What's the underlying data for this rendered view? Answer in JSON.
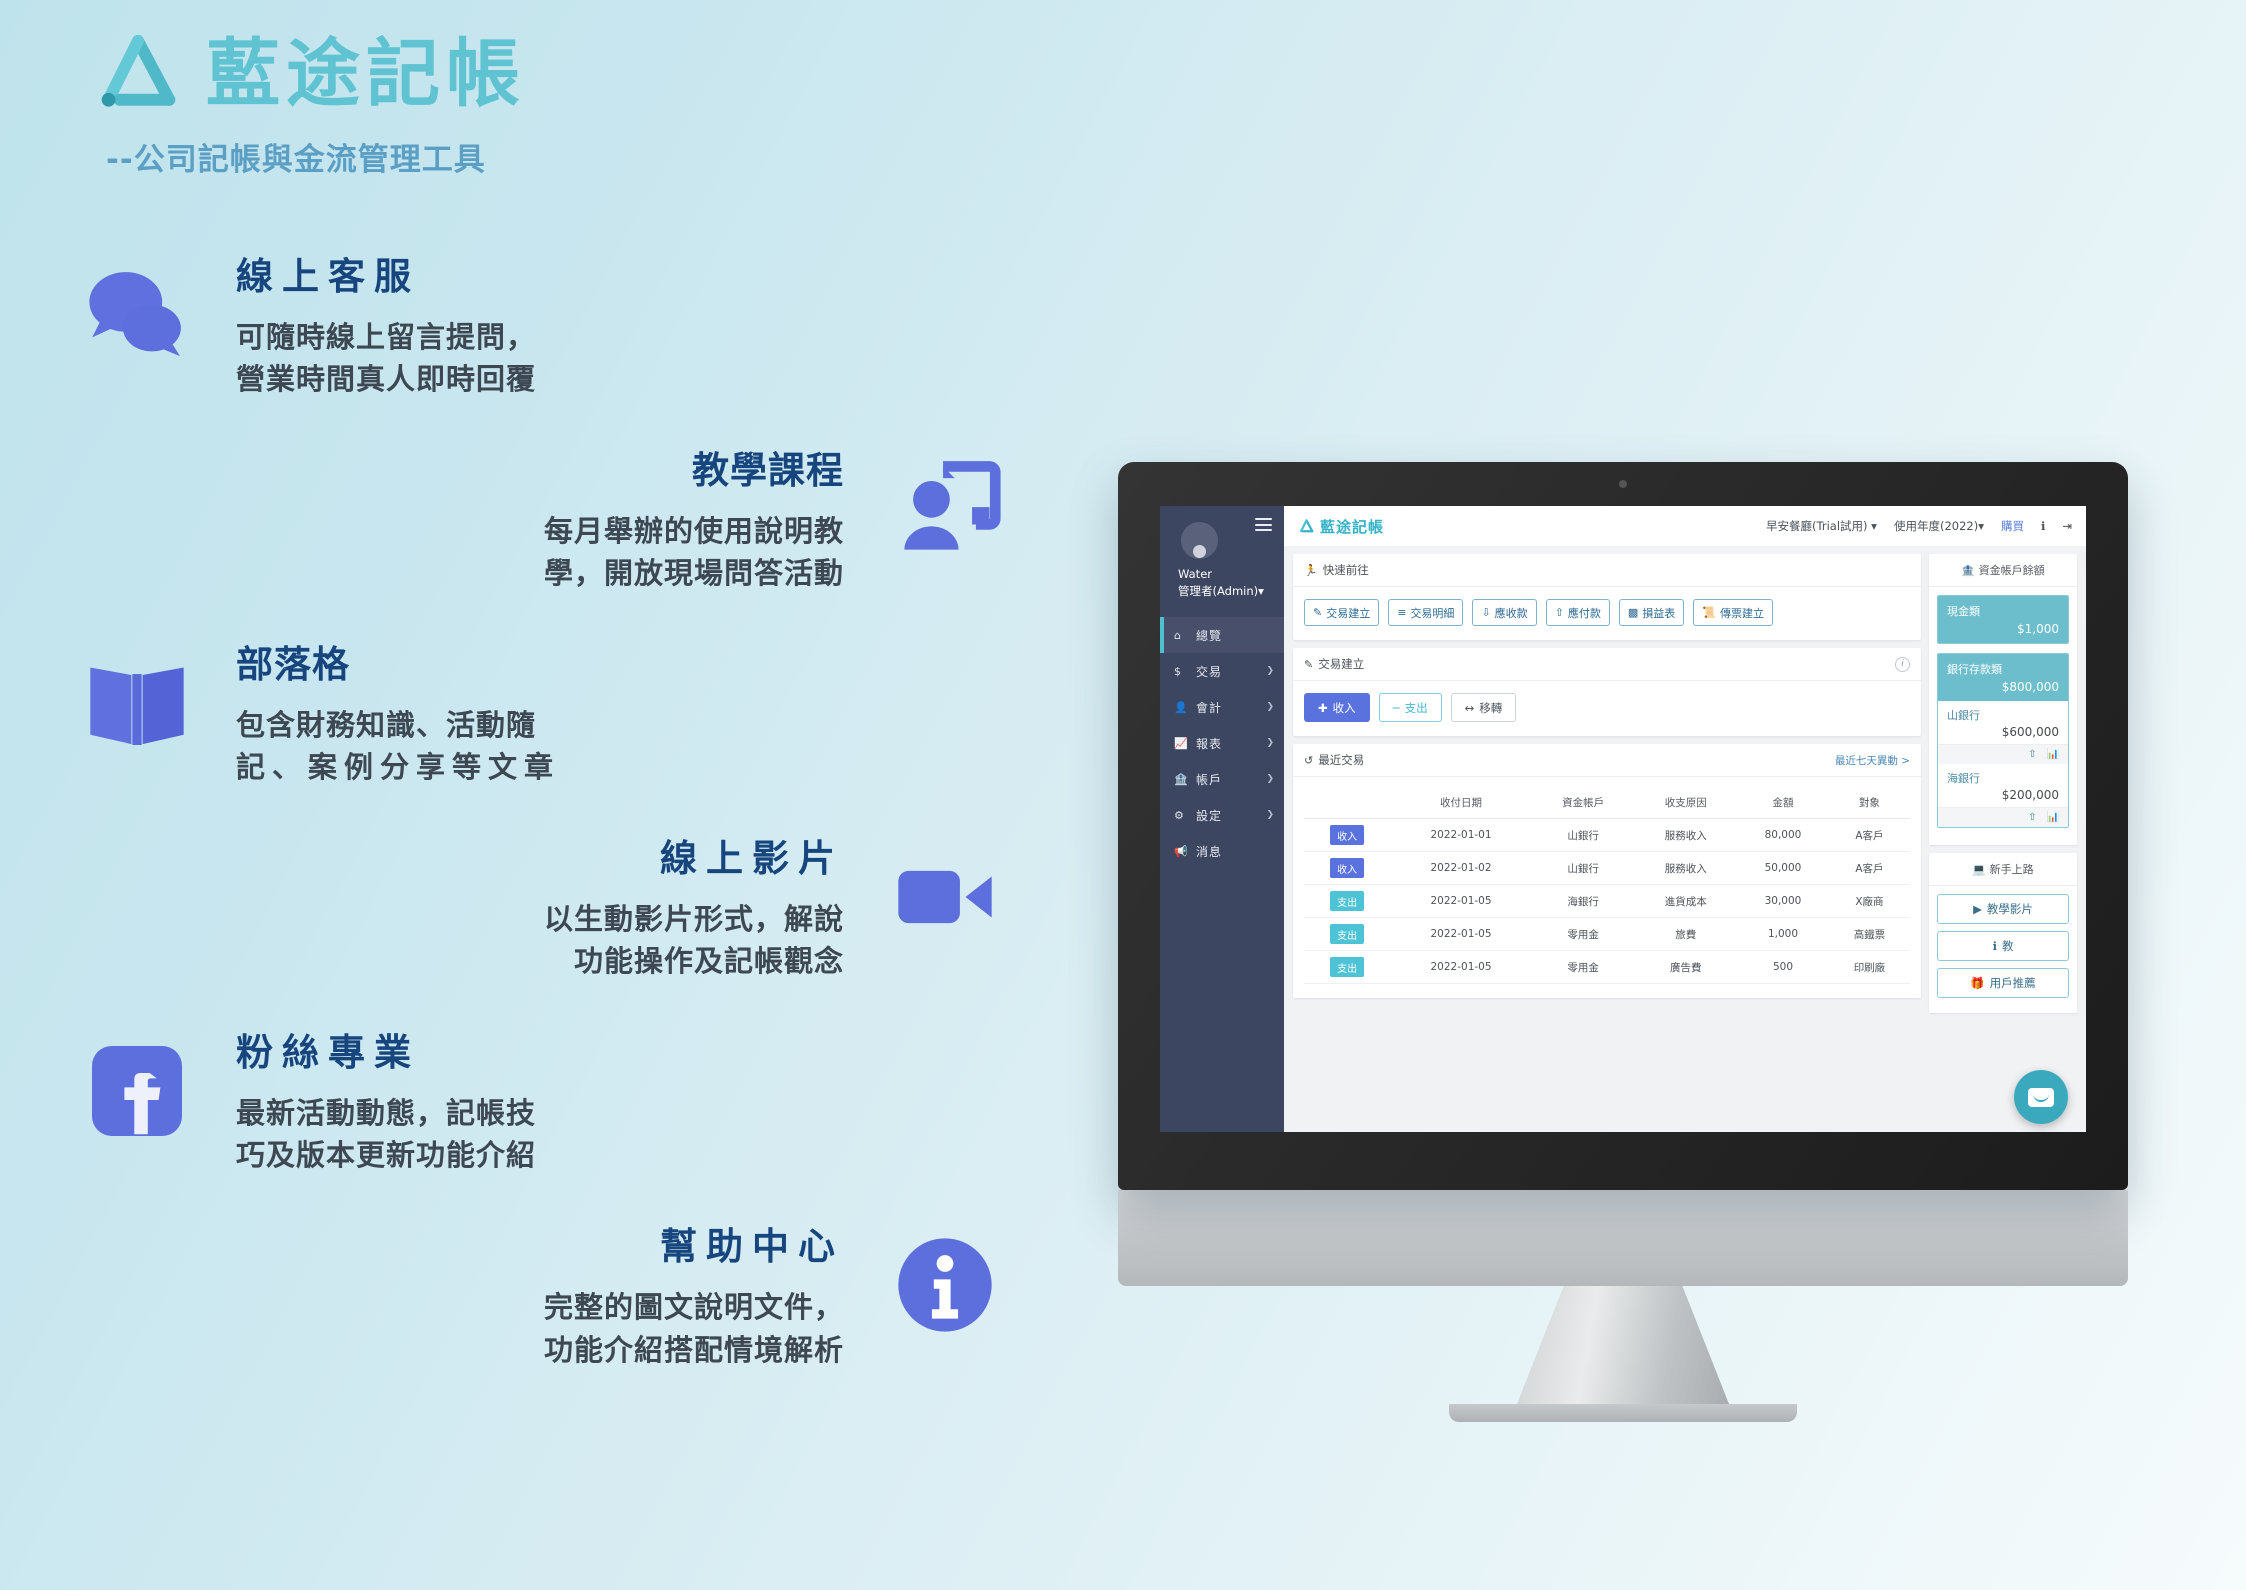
{
  "brand": {
    "title": "藍途記帳",
    "subtitle": "--公司記帳與金流管理工具",
    "logo_icon": "triangle-logo-icon"
  },
  "features": [
    {
      "title": "線上客服",
      "desc_line1": "可隨時線上留言提問，",
      "desc_line2": "營業時間真人即時回覆",
      "icon": "chat-bubbles-icon",
      "side": "left"
    },
    {
      "title": "教學課程",
      "desc_line1": "每月舉辦的使用說明教",
      "desc_line2": "學，開放現場問答活動",
      "icon": "presentation-person-icon",
      "side": "right"
    },
    {
      "title": "部落格",
      "desc_line1": "包含財務知識、活動隨",
      "desc_line2": "記、案例分享等文章",
      "icon": "open-book-icon",
      "side": "left"
    },
    {
      "title": "線上影片",
      "desc_line1": "以生動影片形式，解說",
      "desc_line2": "功能操作及記帳觀念",
      "icon": "video-camera-icon",
      "side": "right"
    },
    {
      "title": "粉絲專業",
      "desc_line1": "最新活動動態，記帳技",
      "desc_line2": "巧及版本更新功能介紹",
      "icon": "facebook-icon",
      "side": "left"
    },
    {
      "title": "幫助中心",
      "desc_line1": "完整的圖文說明文件，",
      "desc_line2": "功能介紹搭配情境解析",
      "icon": "info-circle-icon",
      "side": "right"
    }
  ],
  "app": {
    "sidebar": {
      "user_name": "Water",
      "user_role": "管理者(Admin)",
      "avatar": "user-avatar",
      "menu_icon": "hamburger-icon",
      "items": [
        {
          "label": "總覽",
          "icon": "home-icon",
          "caret": "",
          "active": true
        },
        {
          "label": "交易",
          "icon": "dollar-icon",
          "caret": "❯",
          "active": false
        },
        {
          "label": "會計",
          "icon": "person-icon",
          "caret": "❯",
          "active": false
        },
        {
          "label": "報表",
          "icon": "chart-icon",
          "caret": "❯",
          "active": false
        },
        {
          "label": "帳戶",
          "icon": "bank-icon",
          "caret": "❯",
          "active": false
        },
        {
          "label": "設定",
          "icon": "gear-icon",
          "caret": "❯",
          "active": false
        },
        {
          "label": "消息",
          "icon": "megaphone-icon",
          "caret": "",
          "active": false
        }
      ]
    },
    "header": {
      "logo_text": "藍途記帳",
      "company": "早安餐廳(Trial試用)",
      "company_caret": "▾",
      "year": "使用年度(2022)",
      "year_caret": "▾",
      "buy": "購買",
      "info_icon": "info-icon",
      "logout_icon": "logout-icon"
    },
    "quick_access": {
      "title": "快速前往",
      "icon": "runner-icon",
      "buttons": [
        {
          "label": "交易建立",
          "icon": "pencil-icon"
        },
        {
          "label": "交易明細",
          "icon": "list-icon"
        },
        {
          "label": "應收款",
          "icon": "receive-icon"
        },
        {
          "label": "應付款",
          "icon": "pay-icon"
        },
        {
          "label": "損益表",
          "icon": "bar-chart-icon"
        },
        {
          "label": "傳票建立",
          "icon": "voucher-icon"
        }
      ]
    },
    "create_tx": {
      "title": "交易建立",
      "icon": "pencil-icon",
      "info_icon": "info-circle-icon",
      "buttons": [
        {
          "label": "收入",
          "icon": "plus-icon",
          "style": "income"
        },
        {
          "label": "支出",
          "icon": "minus-icon",
          "style": "expense"
        },
        {
          "label": "移轉",
          "icon": "arrows-icon",
          "style": "transfer"
        }
      ]
    },
    "recent_tx": {
      "title": "最近交易",
      "icon": "history-icon",
      "link": "最近七天異動 >",
      "columns": [
        "",
        "收付日期",
        "資金帳戶",
        "收支原因",
        "金額",
        "對象"
      ],
      "rows": [
        {
          "tag": "收入",
          "type": "in",
          "date": "2022-01-01",
          "account": "山銀行",
          "reason": "服務收入",
          "amount": "80,000",
          "target": "A客戶"
        },
        {
          "tag": "收入",
          "type": "in",
          "date": "2022-01-02",
          "account": "山銀行",
          "reason": "服務收入",
          "amount": "50,000",
          "target": "A客戶"
        },
        {
          "tag": "支出",
          "type": "out",
          "date": "2022-01-05",
          "account": "海銀行",
          "reason": "進貨成本",
          "amount": "30,000",
          "target": "X廠商"
        },
        {
          "tag": "支出",
          "type": "out",
          "date": "2022-01-05",
          "account": "零用金",
          "reason": "旅費",
          "amount": "1,000",
          "target": "高鐵票"
        },
        {
          "tag": "支出",
          "type": "out",
          "date": "2022-01-05",
          "account": "零用金",
          "reason": "廣告費",
          "amount": "500",
          "target": "印刷廠"
        }
      ]
    },
    "balance_panel": {
      "title": "資金帳戶餘額",
      "icon": "bank-icon",
      "cash": {
        "label": "現金類",
        "value": "$1,000"
      },
      "bank": {
        "label": "銀行存款類",
        "value": "$800,000",
        "accounts": [
          {
            "name": "山銀行",
            "value": "$600,000",
            "upload_icon": "upload-icon",
            "chart_icon": "chart-icon"
          },
          {
            "name": "海銀行",
            "value": "$200,000",
            "upload_icon": "upload-icon",
            "chart_icon": "chart-icon"
          }
        ]
      }
    },
    "newbie_panel": {
      "title": "新手上路",
      "icon": "presentation-icon",
      "buttons": [
        {
          "label": "教學影片",
          "icon": "play-icon"
        },
        {
          "label": "教",
          "icon": "info-icon"
        },
        {
          "label": "用戶推薦",
          "icon": "gift-icon"
        }
      ]
    },
    "chat_widget": {
      "icon": "chat-icon"
    }
  },
  "colors": {
    "brand_teal": "#5fc3d2",
    "heading_navy": "#17457e",
    "icon_purple": "#5c6fdc",
    "app_sidebar": "#3d4661",
    "accent_cyan": "#4ec3d6",
    "income_blue": "#5a72dd"
  }
}
